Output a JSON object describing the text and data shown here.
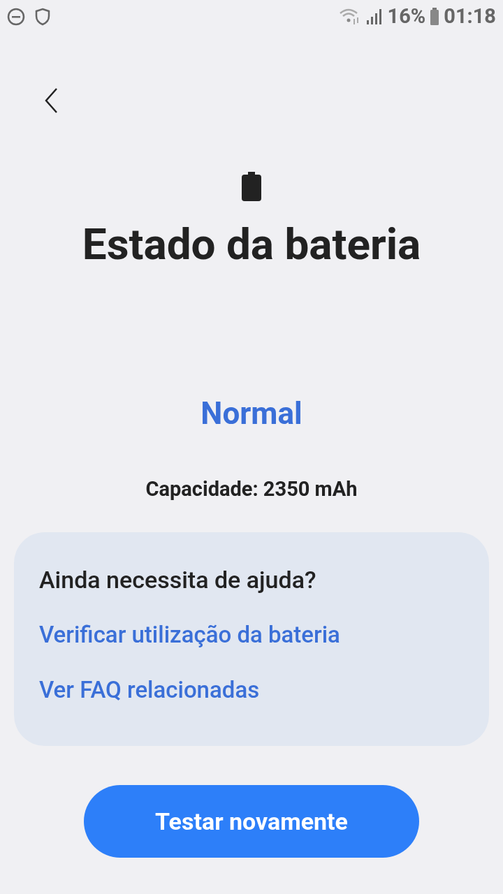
{
  "status_bar": {
    "battery_percent": "16%",
    "time": "01:18"
  },
  "title": "Estado da bateria",
  "status": "Normal",
  "capacity": "Capacidade: 2350 mAh",
  "help_card": {
    "heading": "Ainda necessita de ajuda?",
    "links": [
      "Verificar utilização da bateria",
      "Ver FAQ relacionadas"
    ]
  },
  "button": "Testar novamente"
}
